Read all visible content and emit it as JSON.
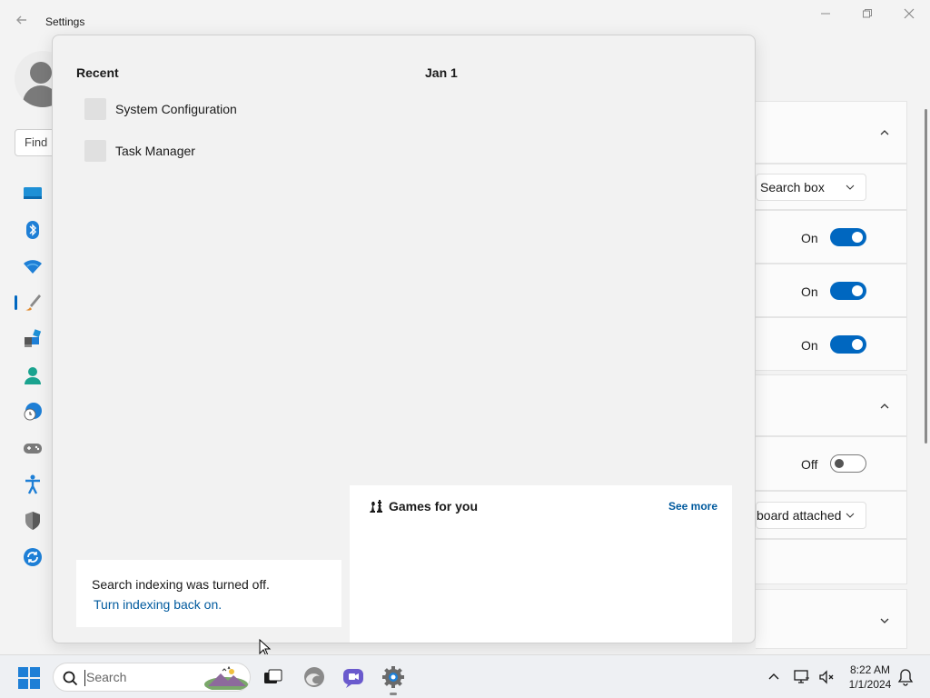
{
  "window": {
    "title": "Settings",
    "find_placeholder": "Find"
  },
  "settings_panel": {
    "dropdown1": "Search box",
    "toggle1": "On",
    "toggle2": "On",
    "toggle3": "On",
    "toggle4": "Off",
    "dropdown2": "board attached"
  },
  "flyout": {
    "recent_heading": "Recent",
    "date_heading": "Jan 1",
    "recent_items": [
      {
        "label": "System Configuration"
      },
      {
        "label": "Task Manager"
      }
    ],
    "notice": {
      "message": "Search indexing was turned off.",
      "link": "Turn indexing back on."
    },
    "games": {
      "title": "Games for you",
      "see_more": "See more"
    }
  },
  "taskbar": {
    "search_placeholder": "Search",
    "time": "8:22 AM",
    "date": "1/1/2024"
  },
  "colors": {
    "accent": "#0067c0",
    "link": "#005a9e"
  }
}
